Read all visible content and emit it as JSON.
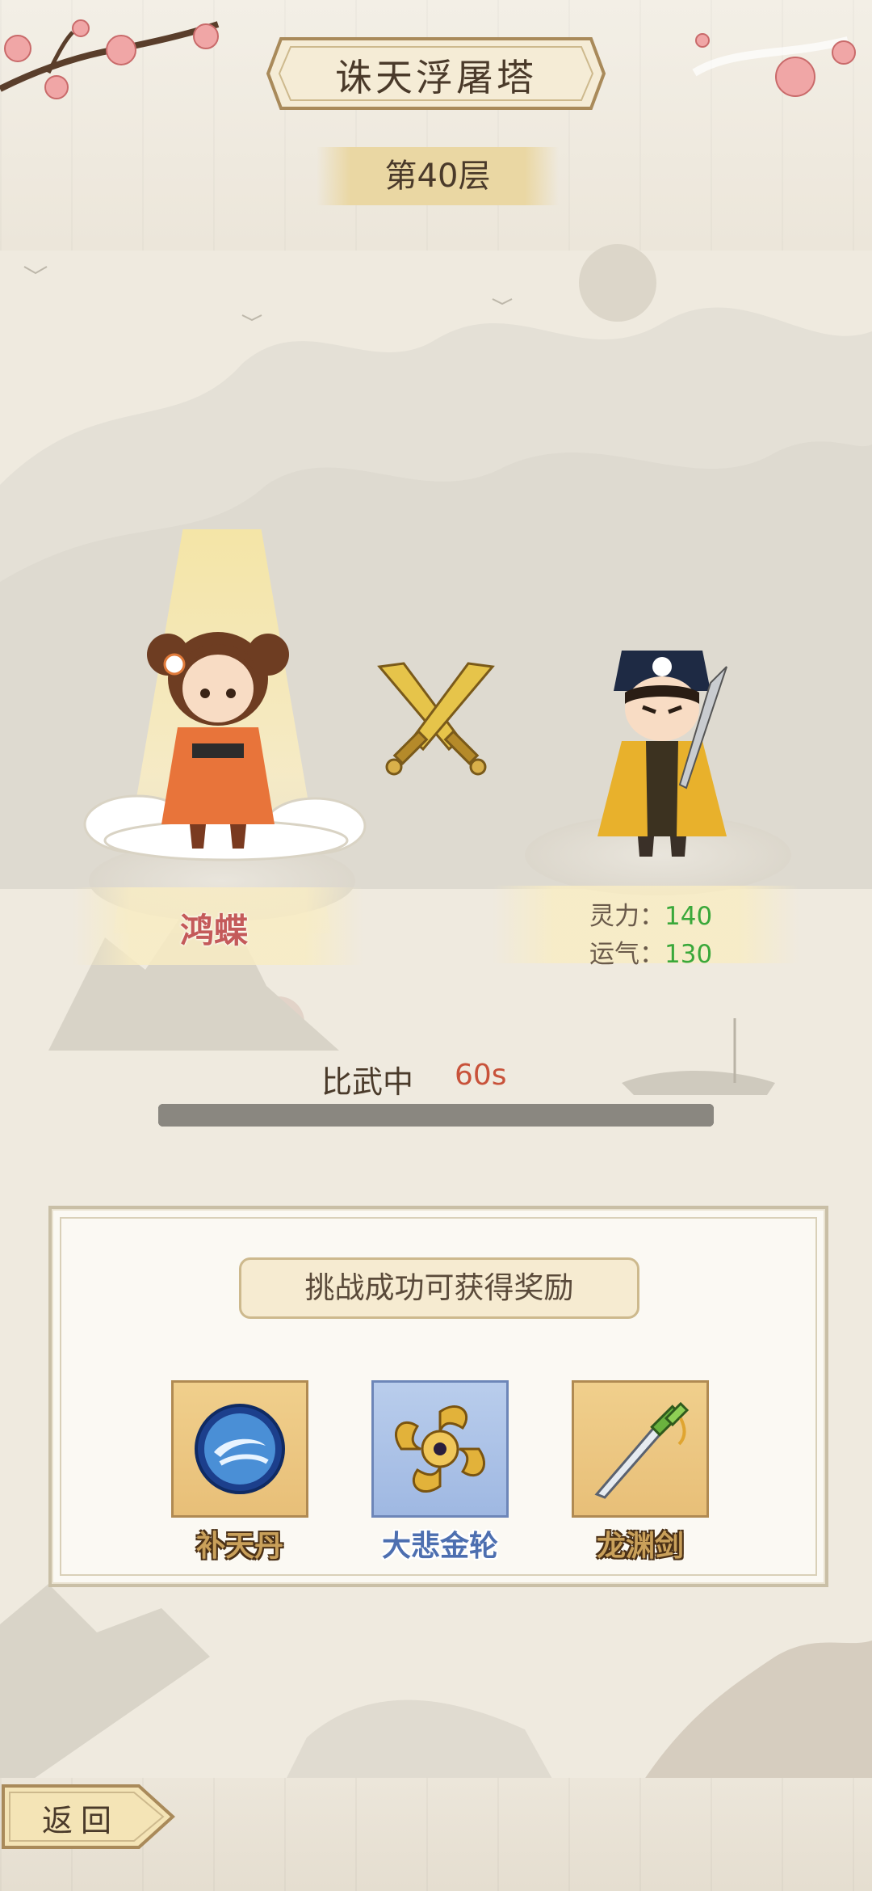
{
  "header": {
    "title": "诛天浮屠塔",
    "floor": "第40层"
  },
  "player": {
    "name": "鸿蝶"
  },
  "opponent": {
    "stats": [
      {
        "label": "灵力：",
        "value": "140"
      },
      {
        "label": "运气：",
        "value": "130"
      }
    ]
  },
  "battle": {
    "status": "比武中",
    "timer": "60s",
    "progress": 1.0
  },
  "rewards": {
    "title": "挑战成功可获得奖励",
    "items": [
      {
        "name": "补天丹",
        "icon": "pill-orb-icon"
      },
      {
        "name": "大悲金轮",
        "icon": "golden-wheel-icon"
      },
      {
        "name": "龙渊剑",
        "icon": "jade-sword-icon"
      }
    ]
  },
  "footer": {
    "back_label": "返回"
  },
  "colors": {
    "accent_red": "#c45a5a",
    "stat_green": "#3aa83a",
    "timer_red": "#c8523a"
  }
}
